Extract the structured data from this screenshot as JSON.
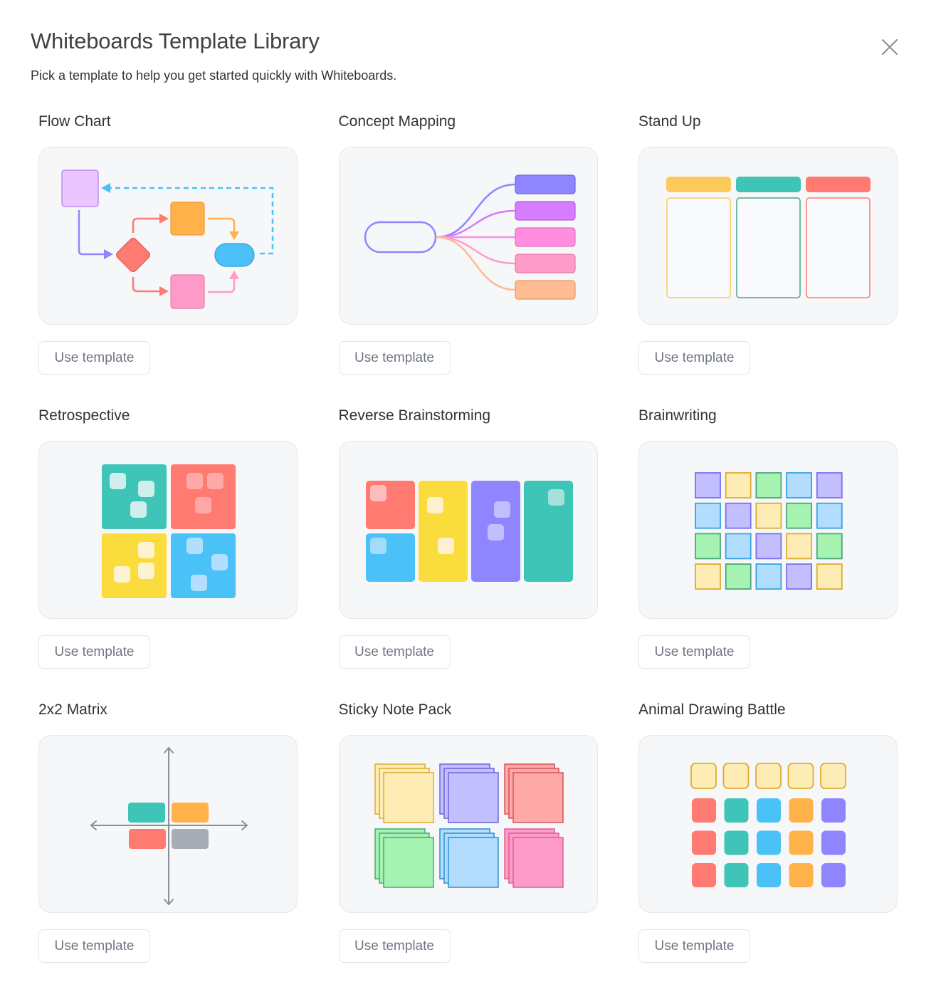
{
  "dialog": {
    "title": "Whiteboards Template Library",
    "subtitle": "Pick a template to help you get started quickly with Whiteboards.",
    "close_icon": "close-icon"
  },
  "templates": [
    {
      "name": "Flow Chart",
      "button": "Use template",
      "preview_icon": "flow-chart-preview"
    },
    {
      "name": "Concept Mapping",
      "button": "Use template",
      "preview_icon": "concept-map-preview"
    },
    {
      "name": "Stand Up",
      "button": "Use template",
      "preview_icon": "stand-up-preview"
    },
    {
      "name": "Retrospective",
      "button": "Use template",
      "preview_icon": "retrospective-preview"
    },
    {
      "name": "Reverse Brainstorming",
      "button": "Use template",
      "preview_icon": "reverse-brainstorming-preview"
    },
    {
      "name": "Brainwriting",
      "button": "Use template",
      "preview_icon": "brainwriting-preview"
    },
    {
      "name": "2x2 Matrix",
      "button": "Use template",
      "preview_icon": "matrix-preview"
    },
    {
      "name": "Sticky Note Pack",
      "button": "Use template",
      "preview_icon": "sticky-note-pack-preview"
    },
    {
      "name": "Animal Drawing Battle",
      "button": "Use template",
      "preview_icon": "animal-drawing-battle-preview"
    }
  ],
  "colors": {
    "red": "#ff7a70",
    "teal": "#3fc4b8",
    "yellow": "#fadc3c",
    "blue": "#4bc2f7",
    "purple": "#8f85fe",
    "orange": "#ffb24a",
    "pink": "#ff9bc9",
    "gray": "#a8acb6"
  }
}
